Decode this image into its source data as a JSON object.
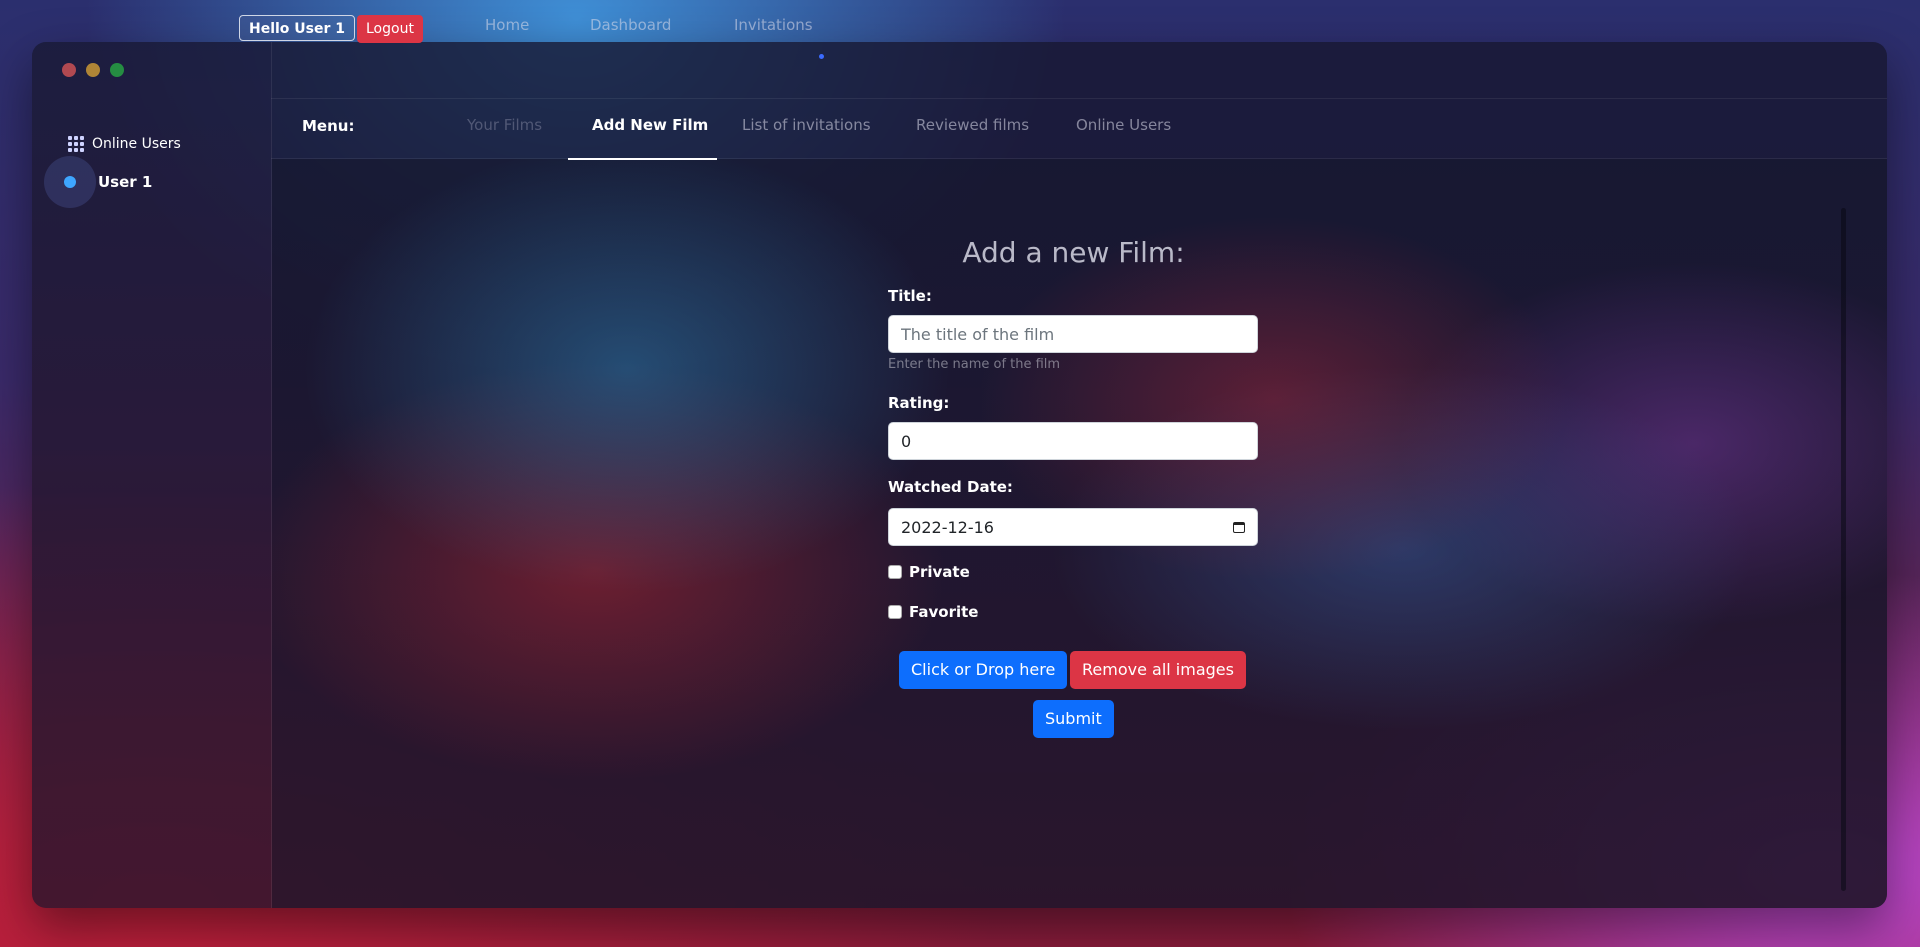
{
  "header": {
    "greeting": "Hello User 1",
    "logout_label": "Logout",
    "nav": [
      "Home",
      "Dashboard",
      "Invitations"
    ]
  },
  "sidebar": {
    "online_title": "Online Users",
    "users": [
      "User 1"
    ]
  },
  "menu": {
    "label": "Menu:",
    "tabs": [
      "Your Films",
      "Add New Film",
      "List of invitations",
      "Reviewed films",
      "Online Users"
    ],
    "active_tab": "Add New Film"
  },
  "form": {
    "title": "Add a new Film:",
    "title_label": "Title:",
    "title_placeholder": "The title of the film",
    "title_hint": "Enter the name of the film",
    "rating_label": "Rating:",
    "rating_value": "0",
    "date_label": "Watched Date:",
    "date_value": "2022-12-16",
    "private_label": "Private",
    "favorite_label": "Favorite",
    "upload_label": "Click or Drop here",
    "remove_label": "Remove all images",
    "submit_label": "Submit"
  },
  "colors": {
    "primary": "#0d6efd",
    "danger": "#dc3545",
    "online_dot": "#3ea6ff"
  }
}
